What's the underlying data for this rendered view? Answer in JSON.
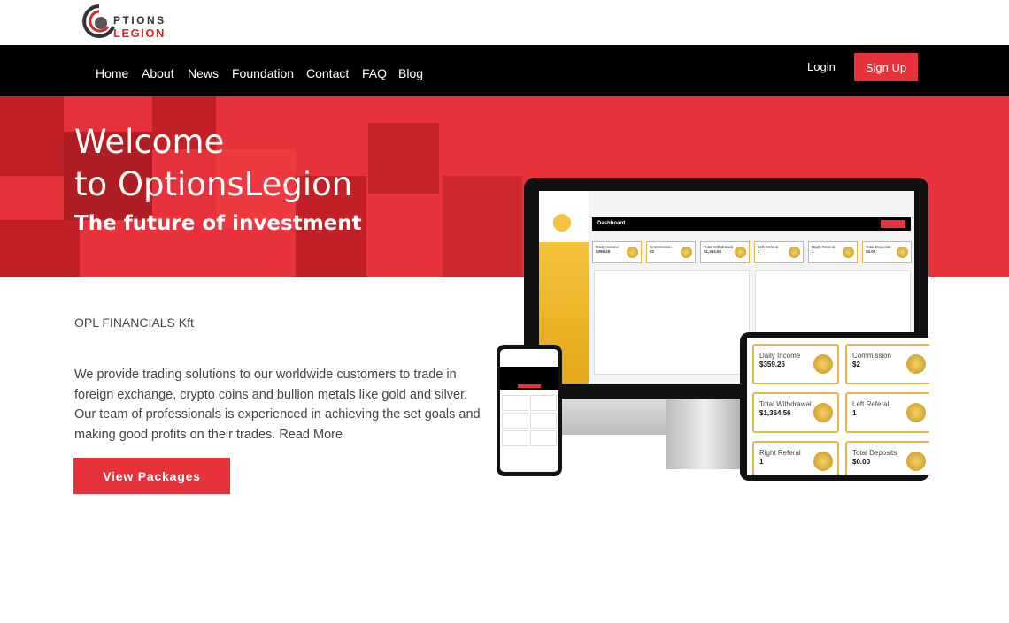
{
  "brand": {
    "logo_line1": "PTIONS",
    "logo_line2": "LEGION"
  },
  "nav": {
    "items": [
      "Home",
      "About",
      "News",
      "Foundation",
      "Contact",
      "FAQ",
      "Blog"
    ],
    "login": "Login",
    "signup": "Sign Up"
  },
  "hero": {
    "title_line1": "Welcome",
    "title_line2": "to OptionsLegion",
    "subtitle": "The future of investment"
  },
  "main": {
    "company": "OPL FINANCIALS Kft",
    "description": "We provide trading solutions to our worldwide customers to trade in foreign exchange, crypto coins and bullion metals like gold and silver. Our team of professionals is experienced in achieving the set goals and making good profits on their trades. Read More",
    "cta": "View Packages"
  },
  "mockup": {
    "dashboard_title": "Dashboard",
    "cards": [
      {
        "label": "Daily Income",
        "value": "$359.26"
      },
      {
        "label": "Commission",
        "value": "$2"
      },
      {
        "label": "Total Withdrawal",
        "value": "$1,364.56"
      },
      {
        "label": "Left Referal",
        "value": "1"
      },
      {
        "label": "Right Referal",
        "value": "1"
      },
      {
        "label": "Total Deposits",
        "value": "$0.00"
      }
    ]
  },
  "colors": {
    "accent": "#e8323b",
    "nav_bg": "#000000",
    "gold": "#e0b84a"
  }
}
